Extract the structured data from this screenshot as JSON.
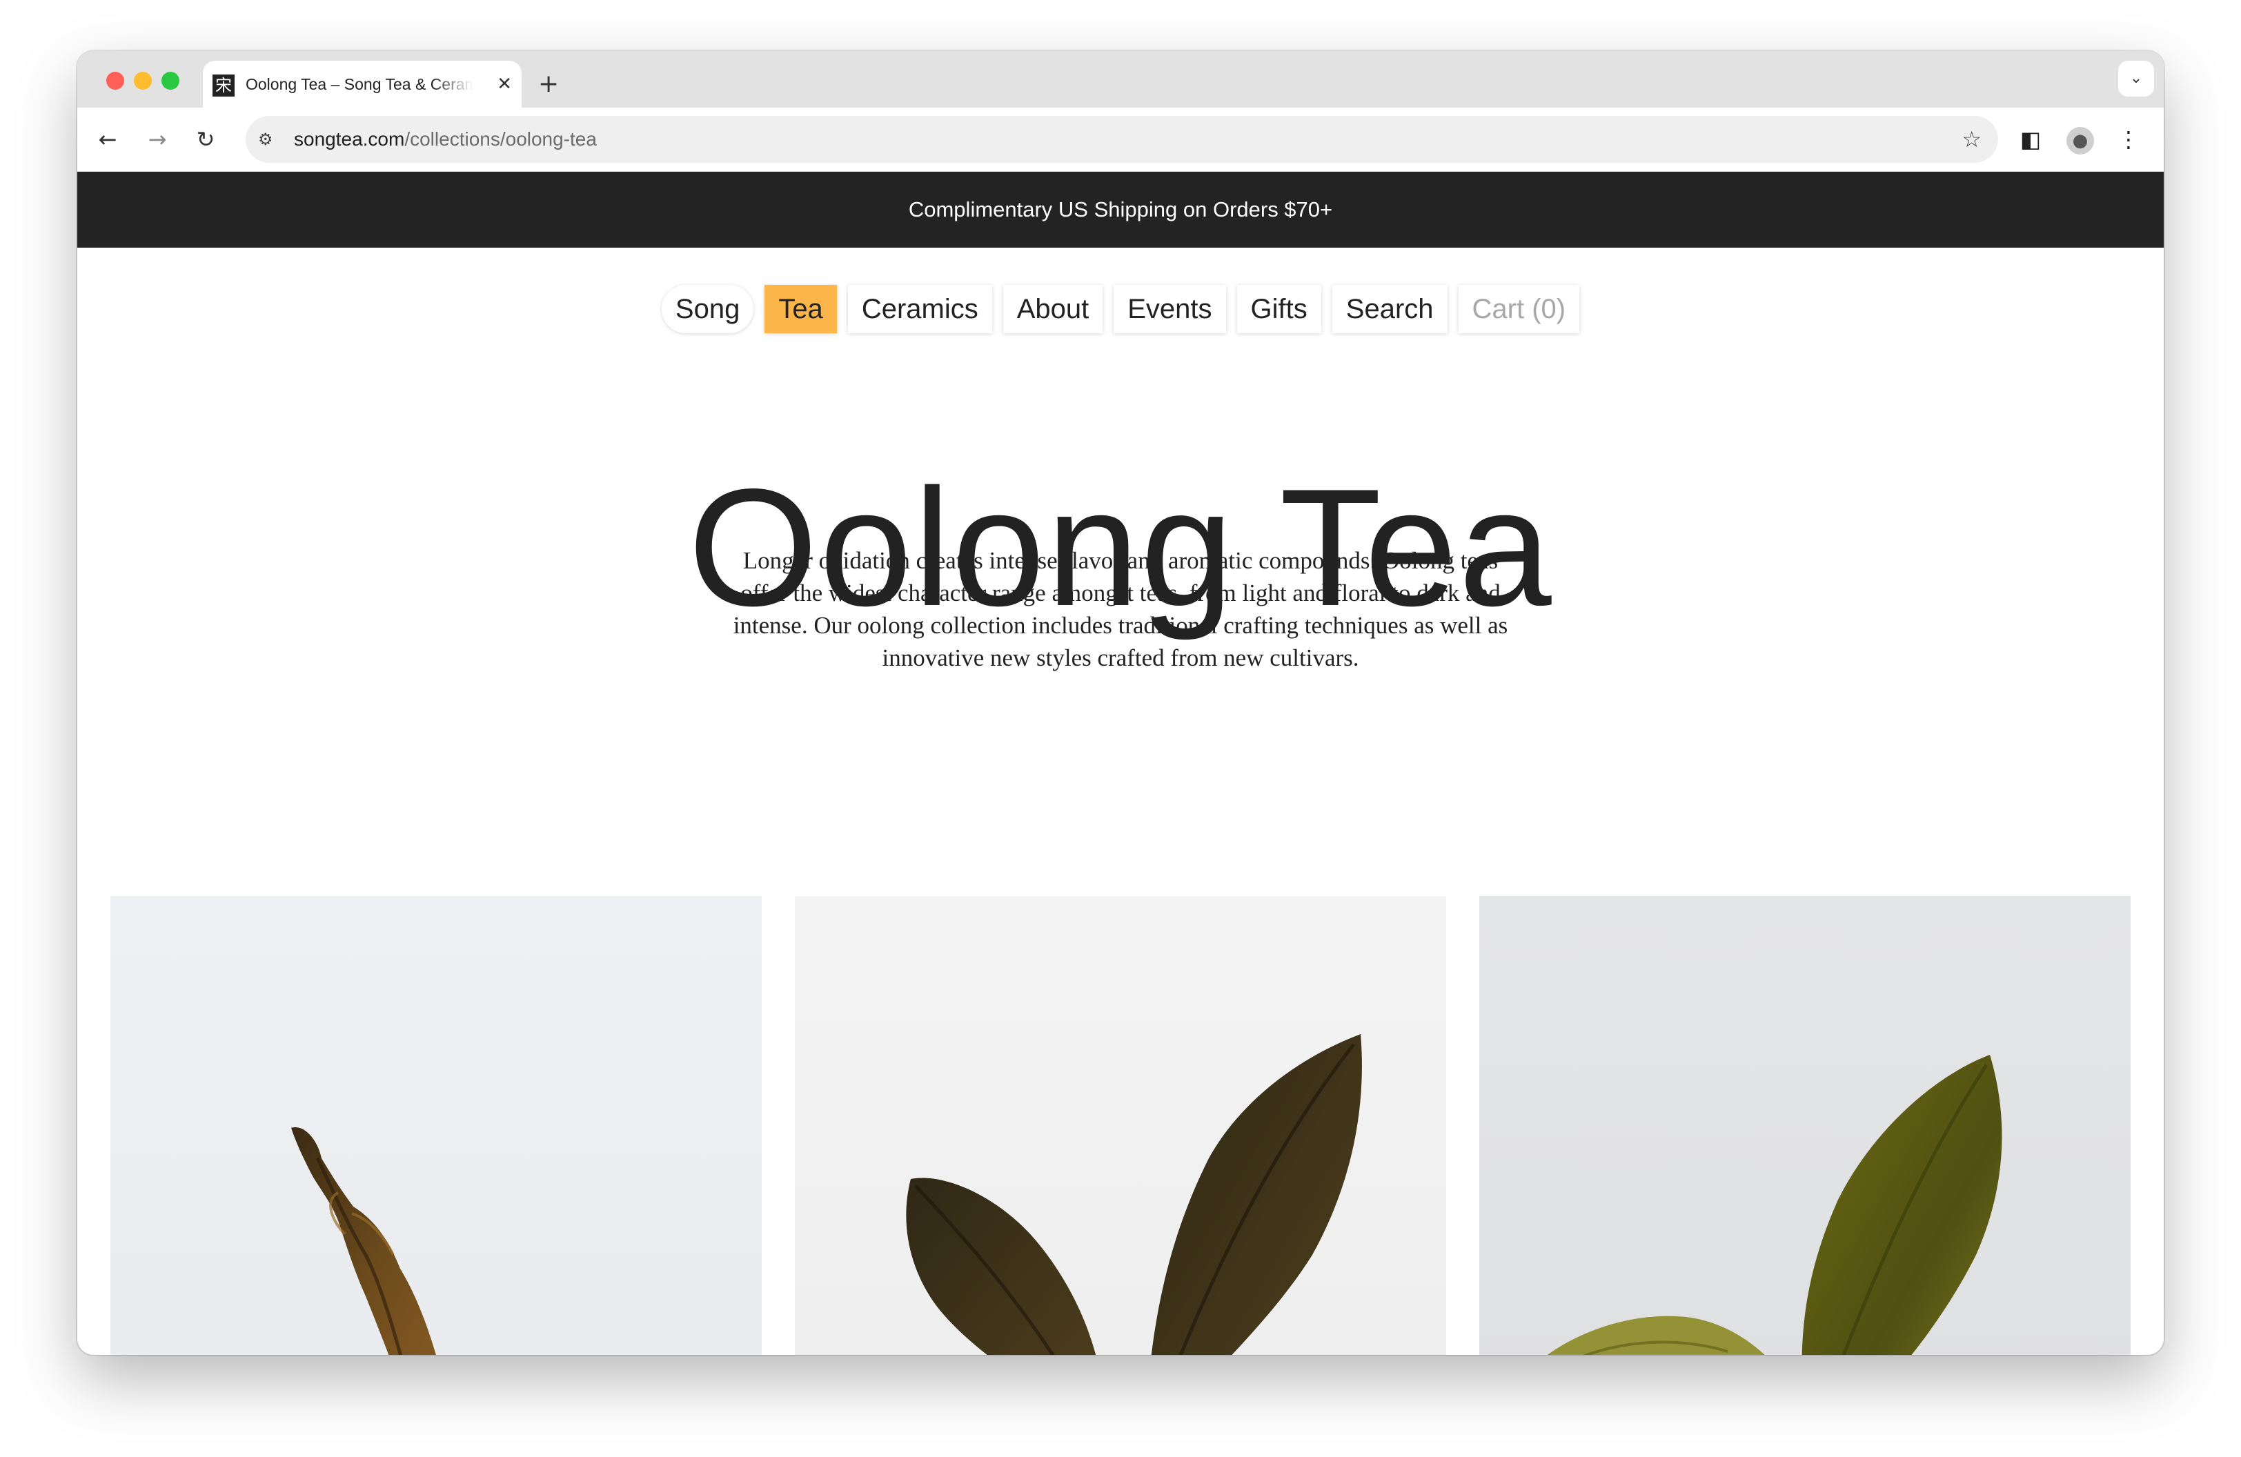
{
  "browser": {
    "tab_title": "Oolong Tea – Song Tea & Ceramics",
    "favicon_glyph": "宋",
    "close_glyph": "✕",
    "new_tab_glyph": "+",
    "tab_menu_glyph": "⌄",
    "url_host": "songtea.com",
    "url_path": "/collections/oolong-tea",
    "icons": {
      "back": "←",
      "forward": "→",
      "reload": "↻",
      "site_info": "⚙",
      "star": "☆",
      "side_panel": "◧",
      "profile": "👤",
      "menu": "⋮"
    }
  },
  "announcement": "Complimentary US Shipping on Orders $70+",
  "nav": {
    "items": [
      {
        "label": "Song"
      },
      {
        "label": "Tea"
      },
      {
        "label": "Ceramics"
      },
      {
        "label": "About"
      },
      {
        "label": "Events"
      },
      {
        "label": "Gifts"
      },
      {
        "label": "Search"
      },
      {
        "label": "Cart (0)"
      }
    ],
    "active": "Tea",
    "active_color": "#fbb548"
  },
  "hero": {
    "title": "Oolong Tea",
    "description": "Longer oxidation creates intense flavor and aromatic compounds. Oolong teas offer the widest character range amongst teas, from light and floral to dark and intense. Our oolong collection includes traditional crafting techniques as well as innovative new styles crafted from new cultivars."
  },
  "products": [
    {
      "image": "twisted-dark-oolong-leaf"
    },
    {
      "image": "two-dark-oolong-leaves"
    },
    {
      "image": "green-unfurled-oolong-leaf"
    }
  ],
  "colors": {
    "announcement_bg": "#232323",
    "text": "#222222"
  }
}
